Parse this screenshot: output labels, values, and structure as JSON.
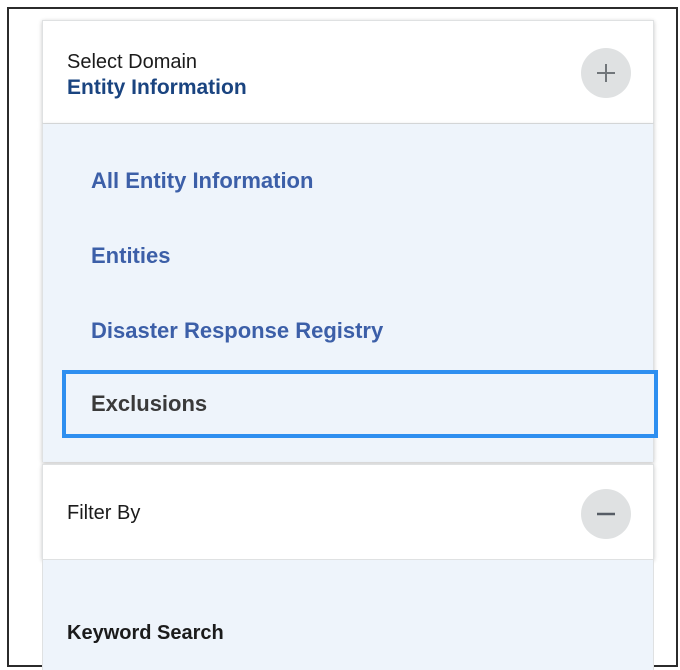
{
  "domain_selector": {
    "label": "Select Domain",
    "selected_domain": "Entity Information",
    "toggle_icon": "plus-icon",
    "options": [
      {
        "label": "All Entity Information"
      },
      {
        "label": "Entities"
      },
      {
        "label": "Disaster Response Registry"
      },
      {
        "label": "Exclusions",
        "selected": true
      }
    ]
  },
  "filter": {
    "title": "Filter By",
    "toggle_icon": "minus-icon",
    "keyword_search_label": "Keyword Search"
  },
  "colors": {
    "link": "#3c5fa8",
    "heading_accent": "#1a4480",
    "focus_outline": "#2e8ff0",
    "panel_background": "#eef4fb"
  }
}
